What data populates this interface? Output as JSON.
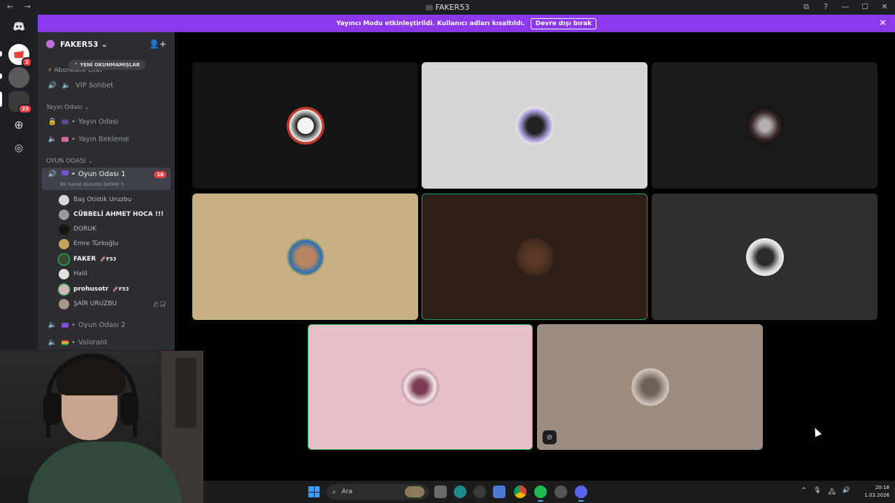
{
  "window": {
    "title": "FAKER53",
    "nav_glyphs": "← →",
    "controls": [
      "⧉",
      "?",
      "—",
      "☐",
      "✕"
    ]
  },
  "banner": {
    "text": "Yayıncı Modu etkinleştirildi. Kullanıcı adları kısaltıldı.",
    "button": "Devre dışı bırak",
    "close": "✕"
  },
  "guilds": [
    {
      "icon": "discord-home-icon",
      "badge": ""
    },
    {
      "icon": "server-icon",
      "badge": "2"
    },
    {
      "icon": "server-icon",
      "badge": ""
    },
    {
      "icon": "server-icon",
      "badge": "23"
    },
    {
      "icon": "add-server-icon",
      "badge": ""
    },
    {
      "icon": "explore-icon",
      "badge": ""
    }
  ],
  "server": {
    "name": "FAKER53",
    "chevron": "⌄"
  },
  "unread_pill": "⌃ YENİ OKUNMAMIŞLAR",
  "sidebar": {
    "cat_sub": "Abonelere Özel",
    "vip": "VIP Sohbet",
    "cat_yayin": "Yayın Odası ⌄",
    "yayin_odasi": "Yayın Odası",
    "yayin_bekleme": "Yayın Bekleme",
    "cat_oyun": "OYUN ODASI ⌄",
    "oyun1": "Oyun Odası 1",
    "oyun1_badge": "16",
    "oyun1_status": "Bir kanal durumu belirle ✎",
    "oyun2": "Oyun Odası 2",
    "valorant": "Valorant"
  },
  "members": [
    {
      "name": "Baş Otistik Uruzbu",
      "tag": "",
      "bold": false,
      "icons": ""
    },
    {
      "name": "CÜBBELİ AHMET HOCA !!!",
      "tag": "",
      "bold": true,
      "icons": ""
    },
    {
      "name": "DORUK",
      "tag": "",
      "bold": false,
      "icons": ""
    },
    {
      "name": "Emre Türkoğlu",
      "tag": "",
      "bold": false,
      "icons": ""
    },
    {
      "name": "FAKER",
      "tag": "🚀F53",
      "bold": true,
      "icons": ""
    },
    {
      "name": "Halil",
      "tag": "",
      "bold": false,
      "icons": ""
    },
    {
      "name": "prohusotr",
      "tag": "🚀F53",
      "bold": true,
      "icons": ""
    },
    {
      "name": "ŞAİR URUZBU",
      "tag": "",
      "bold": false,
      "icons": "🎙̸ 🎧̸"
    }
  ],
  "colors": {
    "tile_bgs": [
      "#141414",
      "#d6d6d6",
      "#1a1a1a",
      "#c7b182",
      "#2d1f18",
      "#2f2f2f",
      "#e8c0c9",
      "#9b8d82"
    ],
    "accent": "#8c39ee",
    "speaking": "#23a55a"
  },
  "taskbar": {
    "search": "Ara",
    "time": "20:18",
    "date": "1.03.2026",
    "tray": [
      "^",
      "🎙",
      "🖧",
      "🔊"
    ]
  }
}
